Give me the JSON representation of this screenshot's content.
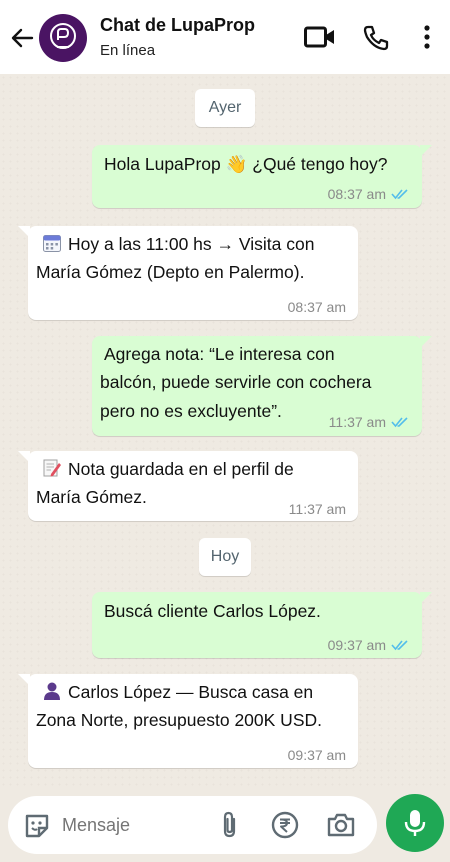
{
  "header": {
    "title": "Chat de LupaProp",
    "status": "En línea"
  },
  "chat": {
    "date_yesterday": "Ayer",
    "date_today": "Hoy",
    "messages": [
      {
        "dir": "out",
        "text": "Hola LupaProp 👋 ¿Qué tengo hoy?",
        "time": "08:37 am",
        "read": true
      },
      {
        "dir": "in",
        "line1": "Hoy a las 11:00 hs → Visita con",
        "line2": "María Gómez (Depto en Palermo).",
        "time": "08:37 am"
      },
      {
        "dir": "out",
        "line1": "Agrega nota: “Le interesa con",
        "line2": "balcón, puede servirle con cochera",
        "line3": "pero no es excluyente”.",
        "time": "11:37 am",
        "read": true
      },
      {
        "dir": "in",
        "line1": "Nota guardada en el perfil de",
        "line2": "María Gómez.",
        "time": "11:37 am"
      },
      {
        "dir": "out",
        "text": "Buscá cliente Carlos López.",
        "time": "09:37 am",
        "read": true
      },
      {
        "dir": "in",
        "line1": "Carlos López — Busca casa en",
        "line2": "Zona Norte, presupuesto 200K USD.",
        "time": "09:37 am"
      }
    ]
  },
  "input": {
    "placeholder": "Mensaje"
  },
  "icons": {
    "back": "arrow-left-icon",
    "video": "video-camera-icon",
    "phone": "phone-icon",
    "menu": "more-vertical-icon",
    "sticker": "sticker-icon",
    "attach": "paperclip-icon",
    "payment": "rupee-icon",
    "camera": "camera-icon",
    "mic": "microphone-icon"
  },
  "colors": {
    "outgoing_bubble": "#d9fdd3",
    "incoming_bubble": "#ffffff",
    "chat_background": "#efeae2",
    "read_ticks": "#53bdeb",
    "mic_button": "#1fa855",
    "avatar": "#4a1463"
  }
}
